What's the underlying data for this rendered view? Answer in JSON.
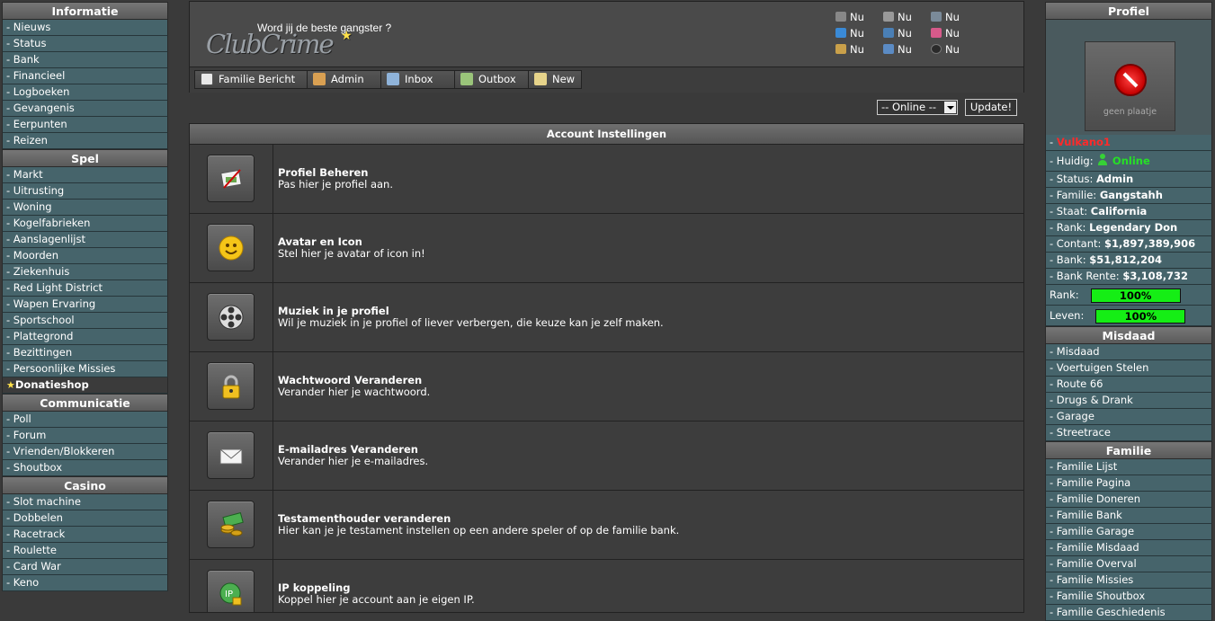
{
  "left_sidebar": {
    "sections": [
      {
        "title": "Informatie",
        "items": [
          "- Nieuws",
          "- Status",
          "- Bank",
          "- Financieel",
          "- Logboeken",
          "- Gevangenis",
          "- Eerpunten",
          "- Reizen"
        ]
      },
      {
        "title": "Spel",
        "items": [
          "- Markt",
          "- Uitrusting",
          "- Woning",
          "- Kogelfabrieken",
          "- Aanslagenlijst",
          "- Moorden",
          "- Ziekenhuis",
          "- Red Light District",
          "- Wapen Ervaring",
          "- Sportschool",
          "- Plattegrond",
          "- Bezittingen",
          "- Persoonlijke Missies"
        ],
        "special": "Donatieshop"
      },
      {
        "title": "Communicatie",
        "items": [
          "- Poll",
          "- Forum",
          "- Vrienden/Blokkeren",
          "- Shoutbox"
        ]
      },
      {
        "title": "Casino",
        "items": [
          "- Slot machine",
          "- Dobbelen",
          "- Racetrack",
          "- Roulette",
          "- Card War",
          "- Keno"
        ]
      }
    ]
  },
  "header": {
    "logo_text": "ClubCrime",
    "tagline": "Word jij de beste gangster ?",
    "timers": [
      "Nu",
      "Nu",
      "Nu",
      "Nu",
      "Nu",
      "Nu",
      "Nu",
      "Nu",
      "Nu"
    ],
    "tabs": [
      {
        "label": "Familie Bericht",
        "icon": "notebook-icon"
      },
      {
        "label": "Admin",
        "icon": "admin-user-icon"
      },
      {
        "label": "Inbox",
        "icon": "inbox-icon"
      },
      {
        "label": "Outbox",
        "icon": "outbox-icon"
      },
      {
        "label": "New",
        "icon": "new-message-icon"
      }
    ]
  },
  "online_select": {
    "value": "-- Online --"
  },
  "update_button": "Update!",
  "panel": {
    "title": "Account Instellingen",
    "rows": [
      {
        "title": "Profiel Beheren",
        "desc": "Pas hier je profiel aan.",
        "icon": "edit-profile-icon"
      },
      {
        "title": "Avatar en Icon",
        "desc": "Stel hier je avatar of icon in!",
        "icon": "smiley-icon"
      },
      {
        "title": "Muziek in je profiel",
        "desc": "Wil je muziek in je profiel of liever verbergen, die keuze kan je zelf maken.",
        "icon": "film-reel-icon"
      },
      {
        "title": "Wachtwoord Veranderen",
        "desc": "Verander hier je wachtwoord.",
        "icon": "padlock-icon"
      },
      {
        "title": "E-mailadres Veranderen",
        "desc": "Verander hier je e-mailadres.",
        "icon": "envelope-icon"
      },
      {
        "title": "Testamenthouder veranderen",
        "desc": "Hier kan je je testament instellen op een andere speler of op de familie bank.",
        "icon": "money-icon"
      },
      {
        "title": "IP koppeling",
        "desc": "Koppel hier je account aan je eigen IP.",
        "icon": "ip-lock-icon"
      }
    ]
  },
  "right_sidebar": {
    "profile_title": "Profiel",
    "no_image_caption": "geen plaatje",
    "username": "Vulkano1",
    "huidig_label": "- Huidig:",
    "huidig_value": "Online",
    "stats": [
      {
        "label": "- Status:",
        "value": "Admin"
      },
      {
        "label": "- Familie:",
        "value": "Gangstahh"
      },
      {
        "label": "- Staat:",
        "value": "California"
      },
      {
        "label": "- Rank:",
        "value": "Legendary Don"
      },
      {
        "label": "- Contant:",
        "value": "$1,897,389,906"
      },
      {
        "label": "- Bank:",
        "value": "$51,812,204"
      },
      {
        "label": "- Bank Rente:",
        "value": "$3,108,732"
      }
    ],
    "rank_label": "Rank:",
    "rank_percent": "100%",
    "leven_label": "Leven:",
    "leven_percent": "100%",
    "sections": [
      {
        "title": "Misdaad",
        "items": [
          "- Misdaad",
          "- Voertuigen Stelen",
          "- Route 66",
          "- Drugs & Drank",
          "- Garage",
          "- Streetrace"
        ]
      },
      {
        "title": "Familie",
        "items": [
          "- Familie Lijst",
          "- Familie Pagina",
          "- Familie Doneren",
          "- Familie Bank",
          "- Familie Garage",
          "- Familie Misdaad",
          "- Familie Overval",
          "- Familie Missies",
          "- Familie Shoutbox",
          "- Familie Geschiedenis"
        ]
      }
    ]
  },
  "colors": {
    "sidebar_item": "#46646b",
    "bar_green": "#15ee15",
    "online_green": "#26e026",
    "username_red": "#ff2a2a"
  }
}
